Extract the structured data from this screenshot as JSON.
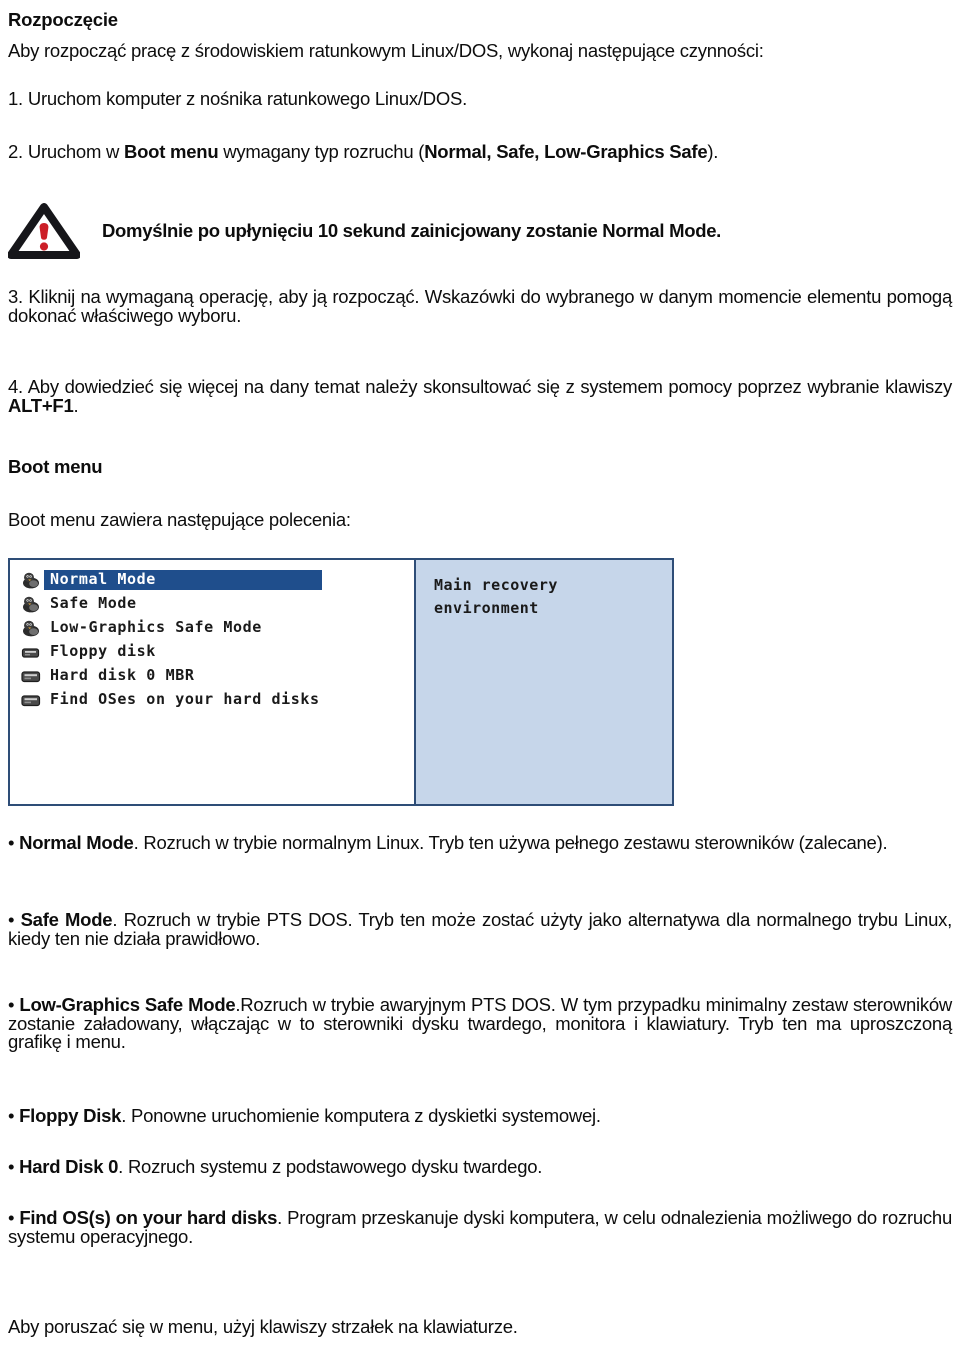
{
  "document": {
    "heading": "Rozpoczęcie",
    "intro": "Aby rozpocząć pracę z  środowiskiem ratunkowym Linux/DOS, wykonaj następujące czynności:",
    "steps": [
      {
        "number": "1.",
        "text_before": " Uruchom komputer z nośnika ratunkowego Linux/DOS.",
        "bold": "",
        "text_after": ""
      },
      {
        "number": "2.",
        "text_before": " Uruchom w ",
        "bold": "Boot menu",
        "text_after": " wymagany typ rozruchu (",
        "bold2": "Normal, Safe, Low-Graphics Safe",
        "text_after2": ")."
      },
      {
        "number": "3.",
        "text_before": " Kliknij na wymaganą operację, aby ją rozpocząć. Wskazówki do wybranego w danym momencie elementu pomogą dokonać właściwego wyboru."
      },
      {
        "number": "4.",
        "text_before": " Aby dowiedzieć się więcej na dany temat należy skonsultować się z systemem pomocy poprzez wybranie klawiszy ",
        "bold": "ALT+F1",
        "text_after": "."
      }
    ],
    "note": {
      "icon": "warning-triangle-icon",
      "text": "Domyślnie po upłynięciu 10 sekund zainicjowany zostanie Normal Mode."
    },
    "boot_menu_heading": "Boot menu",
    "boot_menu_intro": "Boot menu zawiera następujące polecenia:",
    "footer_note": "Aby poruszać się w menu, użyj klawiszy strzałek na klawiaturze."
  },
  "boot_screenshot": {
    "selected_index": 0,
    "items": [
      {
        "label": "Normal Mode",
        "icon": "penguin-icon",
        "selected": true
      },
      {
        "label": "Safe Mode",
        "icon": "penguin-icon",
        "selected": false
      },
      {
        "label": "Low-Graphics Safe Mode",
        "icon": "penguin-icon",
        "selected": false
      },
      {
        "label": "Floppy disk",
        "icon": "floppy-drive-icon",
        "selected": false
      },
      {
        "label": "Hard disk 0 MBR",
        "icon": "hard-disk-icon",
        "selected": false
      },
      {
        "label": "Find OSes on your hard disks",
        "icon": "hard-disk-icon",
        "selected": false
      }
    ],
    "description_panel": "Main recovery\nenvironment",
    "colors": {
      "selection_blue": "#1f4e8c",
      "panel_blue": "#c6d6ea",
      "border_blue": "#2e4d77"
    }
  },
  "bullets": [
    {
      "marker": "•",
      "bold": "Normal Mode",
      "text": ". Rozruch w trybie normalnym Linux. Tryb ten używa pełnego zestawu sterowników (zalecane)."
    },
    {
      "marker": "•",
      "bold": "Safe Mode",
      "text": ". Rozruch w trybie PTS DOS. Tryb ten może zostać użyty jako alternatywa dla normalnego trybu Linux, kiedy ten nie działa prawidłowo."
    },
    {
      "marker": "•",
      "bold": "Low-Graphics Safe Mode",
      "text": ".Rozruch w trybie awaryjnym PTS DOS. W tym przypadku minimalny zestaw sterowników zostanie załadowany, włączając w to sterowniki dysku twardego, monitora i klawiatury. Tryb ten ma uproszczoną grafikę i menu."
    },
    {
      "marker": "•",
      "bold": "Floppy Disk",
      "text": ".  Ponowne uruchomienie komputera z dyskietki systemowej."
    },
    {
      "marker": "•",
      "bold": "Hard Disk 0",
      "text": ".  Rozruch systemu z podstawowego dysku twardego."
    },
    {
      "marker": "•",
      "bold": "Find OS(s) on your hard disks",
      "text": ".  Program przeskanuje dyski komputera, w celu odnalezienia możliwego do rozruchu systemu operacyjnego."
    }
  ]
}
